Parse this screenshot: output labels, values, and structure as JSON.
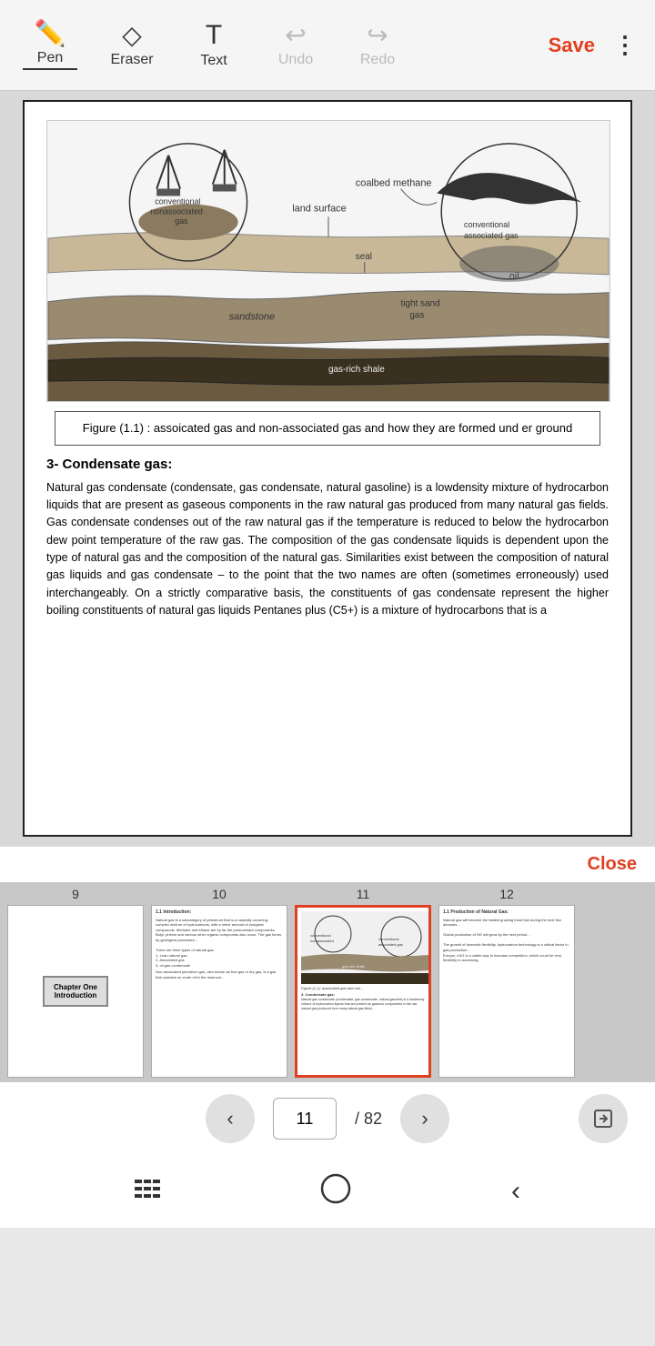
{
  "toolbar": {
    "pen_label": "Pen",
    "eraser_label": "Eraser",
    "text_label": "Text",
    "undo_label": "Undo",
    "redo_label": "Redo",
    "save_label": "Save",
    "more_icon": "⋮"
  },
  "document": {
    "figure_caption": "Figure (1.1) : assoicated gas and non-associated gas and how they are formed und er ground",
    "section_title": "3- Condensate gas:",
    "section_body": "Natural gas condensate (condensate, gas condensate, natural gasoline) is a lowdensity mixture of hydrocarbon liquids that are present as gaseous components in the raw natural gas produced from many natural gas fields. Gas condensate condenses out of the raw natural gas if the temperature is reduced to below the hydrocarbon dew point temperature of the raw gas. The composition of the gas condensate liquids is dependent upon the type of natural gas and the composition of the natural gas. Similarities exist between the composition of natural gas liquids and gas condensate – to the point that the two names are often (sometimes erroneously) used interchangeably. On a strictly comparative basis, the constituents of gas condensate represent the higher boiling constituents of natural gas liquids Pentanes plus (C5+) is a mixture of hydrocarbons that is a"
  },
  "close_bar": {
    "close_label": "Close"
  },
  "thumbnails": [
    {
      "num": "9",
      "type": "chapter",
      "label": "Chapter One\nIntroduction",
      "selected": false
    },
    {
      "num": "10",
      "type": "text",
      "selected": false
    },
    {
      "num": "11",
      "type": "diagram",
      "selected": true
    },
    {
      "num": "12",
      "type": "text",
      "selected": false
    }
  ],
  "page_nav": {
    "current_page": "11",
    "total_pages": "82",
    "prev_icon": "‹",
    "next_icon": "›",
    "share_icon": "⬆"
  },
  "sys_nav": {
    "menu_icon": "|||",
    "home_icon": "○",
    "back_icon": "‹"
  }
}
